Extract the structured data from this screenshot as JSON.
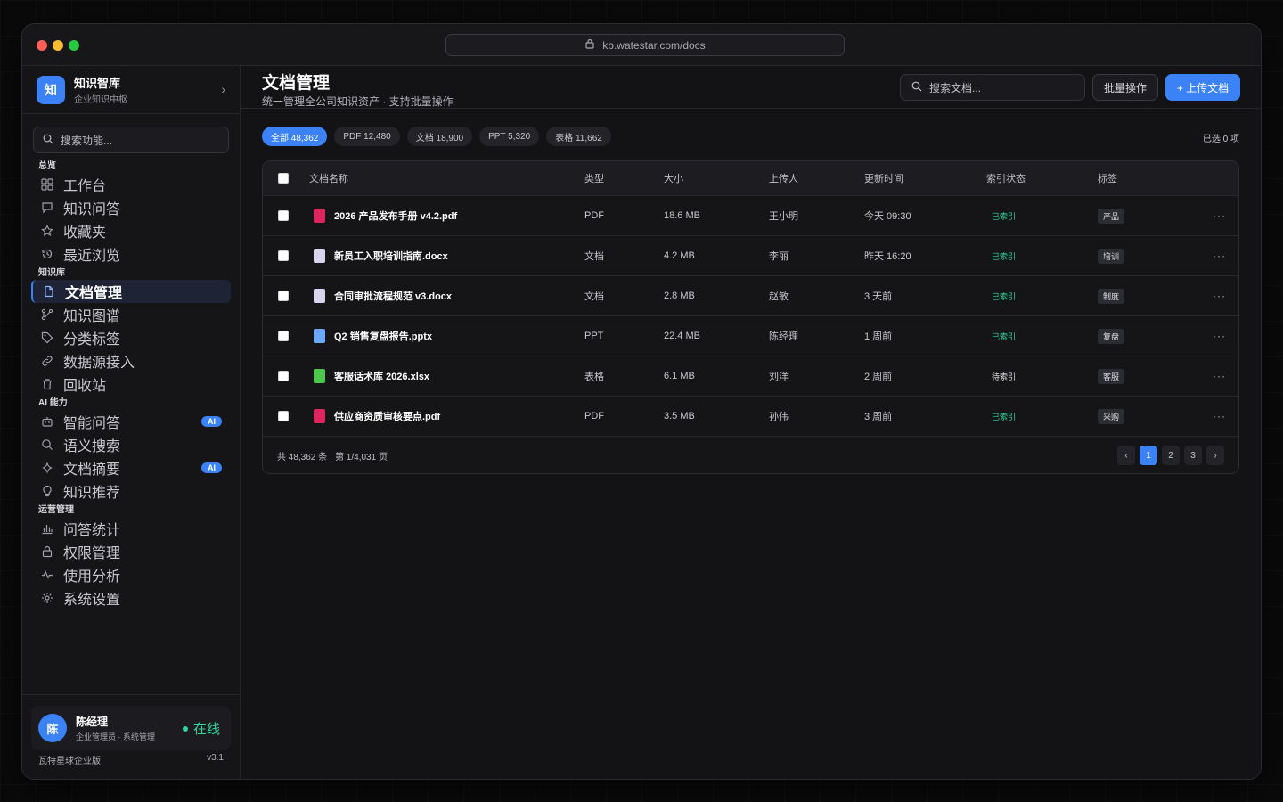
{
  "window": {
    "url": "kb.watestar.com/docs",
    "dot_colors": [
      "#ff5f57",
      "#febc2e",
      "#28c840"
    ]
  },
  "sidebar": {
    "brand": {
      "logo": "知",
      "name": "知识智库",
      "subtitle": "企业知识中枢"
    },
    "search_placeholder": "搜索功能...",
    "sections": [
      {
        "title": "总览",
        "items": [
          {
            "icon": "grid-icon",
            "label": "工作台"
          },
          {
            "icon": "chat-icon",
            "label": "知识问答"
          },
          {
            "icon": "star-icon",
            "label": "收藏夹"
          },
          {
            "icon": "history-icon",
            "label": "最近浏览"
          }
        ]
      },
      {
        "title": "知识库",
        "items": [
          {
            "icon": "document-icon",
            "label": "文档管理",
            "active": true
          },
          {
            "icon": "graph-icon",
            "label": "知识图谱"
          },
          {
            "icon": "tag-icon",
            "label": "分类标签"
          },
          {
            "icon": "link-icon",
            "label": "数据源接入"
          },
          {
            "icon": "trash-icon",
            "label": "回收站"
          }
        ]
      },
      {
        "title": "AI 能力",
        "items": [
          {
            "icon": "robot-icon",
            "label": "智能问答",
            "badge": "AI"
          },
          {
            "icon": "search-icon",
            "label": "语义搜索"
          },
          {
            "icon": "sparkle-icon",
            "label": "文档摘要",
            "badge": "AI"
          },
          {
            "icon": "bulb-icon",
            "label": "知识推荐"
          }
        ]
      },
      {
        "title": "运营管理",
        "items": [
          {
            "icon": "bar-chart-icon",
            "label": "问答统计"
          },
          {
            "icon": "lock-icon",
            "label": "权限管理"
          },
          {
            "icon": "activity-icon",
            "label": "使用分析"
          },
          {
            "icon": "gear-icon",
            "label": "系统设置"
          }
        ]
      }
    ],
    "user": {
      "avatar": "陈",
      "name": "陈经理",
      "role": "企业管理员 · 系统管理",
      "status": "在线"
    },
    "footer": {
      "edition": "瓦特星球企业版",
      "version": "v3.1"
    }
  },
  "header": {
    "title": "文档管理",
    "subtitle": "统一管理全公司知识资产 · 支持批量操作",
    "search_placeholder": "搜索文档...",
    "batch_label": "批量操作",
    "upload_label": "+ 上传文档"
  },
  "filters": [
    {
      "label": "全部 48,362",
      "active": true
    },
    {
      "label": "PDF 12,480"
    },
    {
      "label": "文档 18,900"
    },
    {
      "label": "PPT 5,320"
    },
    {
      "label": "表格 11,662"
    }
  ],
  "selected_count": "已选 0 项",
  "table": {
    "columns": [
      "文档名称",
      "类型",
      "大小",
      "上传人",
      "更新时间",
      "索引状态",
      "标签"
    ],
    "rows": [
      {
        "name": "2026 产品发布手册 v4.2.pdf",
        "icon_color": "#e0245e",
        "type": "PDF",
        "size": "18.6 MB",
        "uploader": "王小明",
        "updated": "今天 09:30",
        "status": "已索引",
        "tag": "产品"
      },
      {
        "name": "新员工入职培训指南.docx",
        "icon_color": "#d8d4ee",
        "type": "文档",
        "size": "4.2 MB",
        "uploader": "李丽",
        "updated": "昨天 16:20",
        "status": "已索引",
        "tag": "培训"
      },
      {
        "name": "合同审批流程规范 v3.docx",
        "icon_color": "#d8d4ee",
        "type": "文档",
        "size": "2.8 MB",
        "uploader": "赵敏",
        "updated": "3 天前",
        "status": "已索引",
        "tag": "制度"
      },
      {
        "name": "Q2 销售复盘报告.pptx",
        "icon_color": "#6aa7ff",
        "type": "PPT",
        "size": "22.4 MB",
        "uploader": "陈经理",
        "updated": "1 周前",
        "status": "已索引",
        "tag": "复盘"
      },
      {
        "name": "客服话术库 2026.xlsx",
        "icon_color": "#4cc94c",
        "type": "表格",
        "size": "6.1 MB",
        "uploader": "刘洋",
        "updated": "2 周前",
        "status": "待索引",
        "tag": "客服"
      },
      {
        "name": "供应商资质审核要点.pdf",
        "icon_color": "#e0245e",
        "type": "PDF",
        "size": "3.5 MB",
        "uploader": "孙伟",
        "updated": "3 周前",
        "status": "已索引",
        "tag": "采购"
      }
    ],
    "footer_text": "共 48,362 条 · 第 1/4,031 页",
    "pages": [
      "‹",
      "1",
      "2",
      "3",
      "›"
    ],
    "active_page": "1"
  },
  "colors": {
    "accent": "#3b82f6",
    "success": "#34d399"
  }
}
